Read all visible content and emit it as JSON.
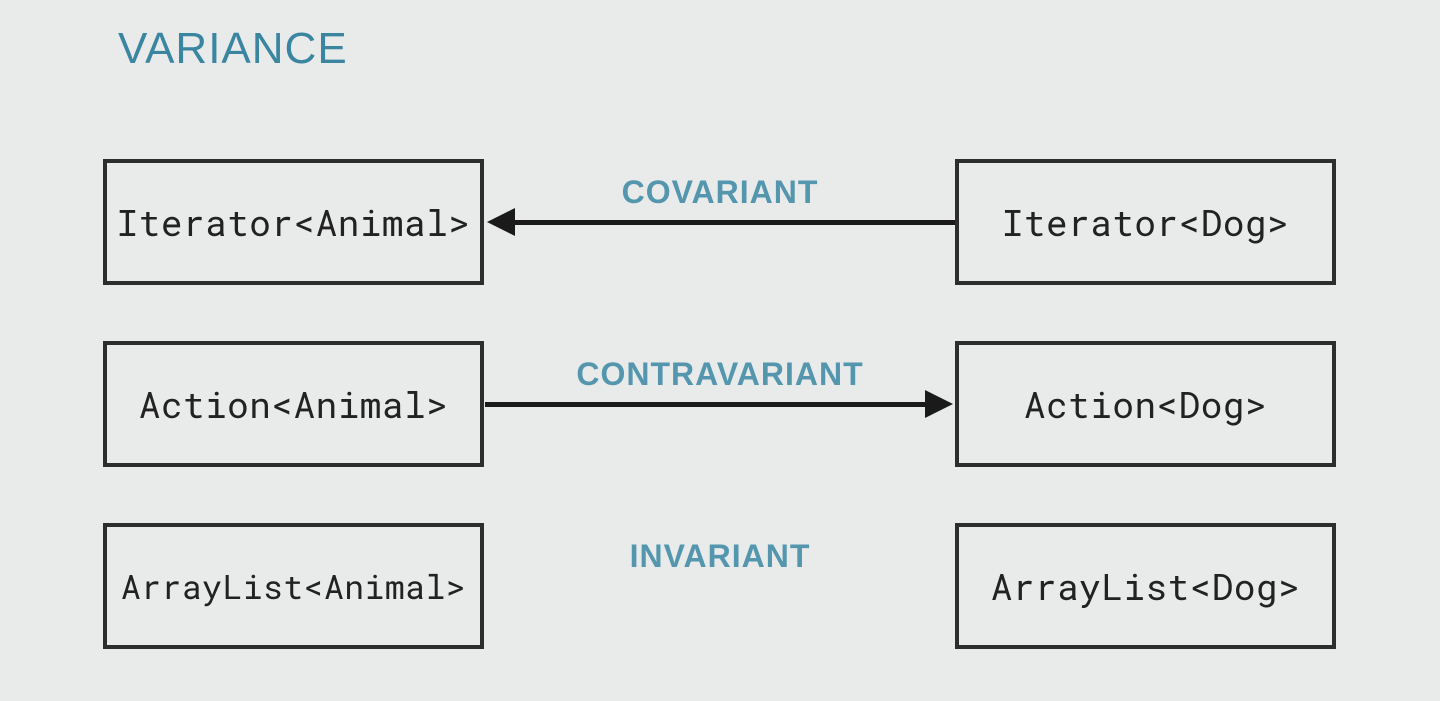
{
  "title": "VARIANCE",
  "rows": [
    {
      "left": "Iterator<Animal>",
      "right": "Iterator<Dog>",
      "label": "COVARIANT",
      "arrow": "left"
    },
    {
      "left": "Action<Animal>",
      "right": "Action<Dog>",
      "label": "CONTRAVARIANT",
      "arrow": "right"
    },
    {
      "left": "ArrayList<Animal>",
      "right": "ArrayList<Dog>",
      "label": "INVARIANT",
      "arrow": "none"
    }
  ],
  "colors": {
    "accent": "#5396ad",
    "titleAccent": "#3a85a0",
    "ink": "#2d2d2d",
    "bg": "#e9eaea"
  }
}
